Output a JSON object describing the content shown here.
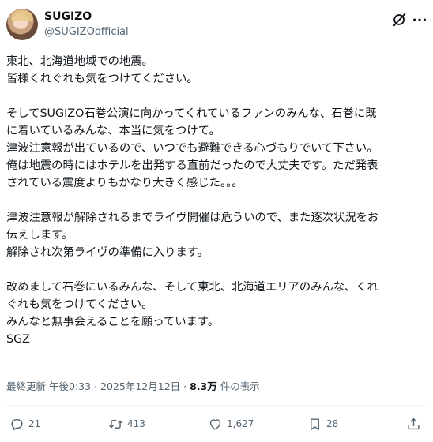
{
  "author": {
    "name": "SUGIZO",
    "handle": "@SUGIZOofficial"
  },
  "post": {
    "paragraphs": [
      [
        "東北、北海道地域での地震。",
        "皆様くれぐれも気をつけてください。"
      ],
      [
        "そしてSUGIZO石巻公演に向かってくれているファンのみんな、石巻に既",
        "に着いているみんな、本当に気をつけて。",
        "津波注意報が出ているので、いつでも避難できる心づもりでいて下さい。",
        "俺は地震の時にはホテルを出発する直前だったので大丈夫です。ただ発表",
        "されている震度よりもかなり大きく感じた。。。"
      ],
      [
        "津波注意報が解除されるまでライヴ開催は危ういので、また逐次状況をお",
        "伝えします。",
        "解除され次第ライヴの準備に入ります。"
      ],
      [
        "改めまして石巻にいるみんな、そして東北、北海道エリアのみんな、くれ",
        "ぐれも気をつけてください。",
        "みんなと無事会えることを願っています。",
        "SGZ"
      ]
    ]
  },
  "meta": {
    "edited_label": "最終更新",
    "time": "午後0:33",
    "separator": "·",
    "date": "2025年12月12日",
    "views_count": "8.3万",
    "views_label": "件の表示"
  },
  "actions": {
    "replies": "21",
    "reposts": "413",
    "likes": "1,627",
    "bookmarks": "28"
  },
  "icons": [
    "grok-icon",
    "more-icon",
    "reply-icon",
    "repost-icon",
    "like-icon",
    "bookmark-icon",
    "share-icon"
  ],
  "colors": {
    "text": "#0f1419",
    "secondary": "#536471",
    "divider": "#eff3f4"
  }
}
